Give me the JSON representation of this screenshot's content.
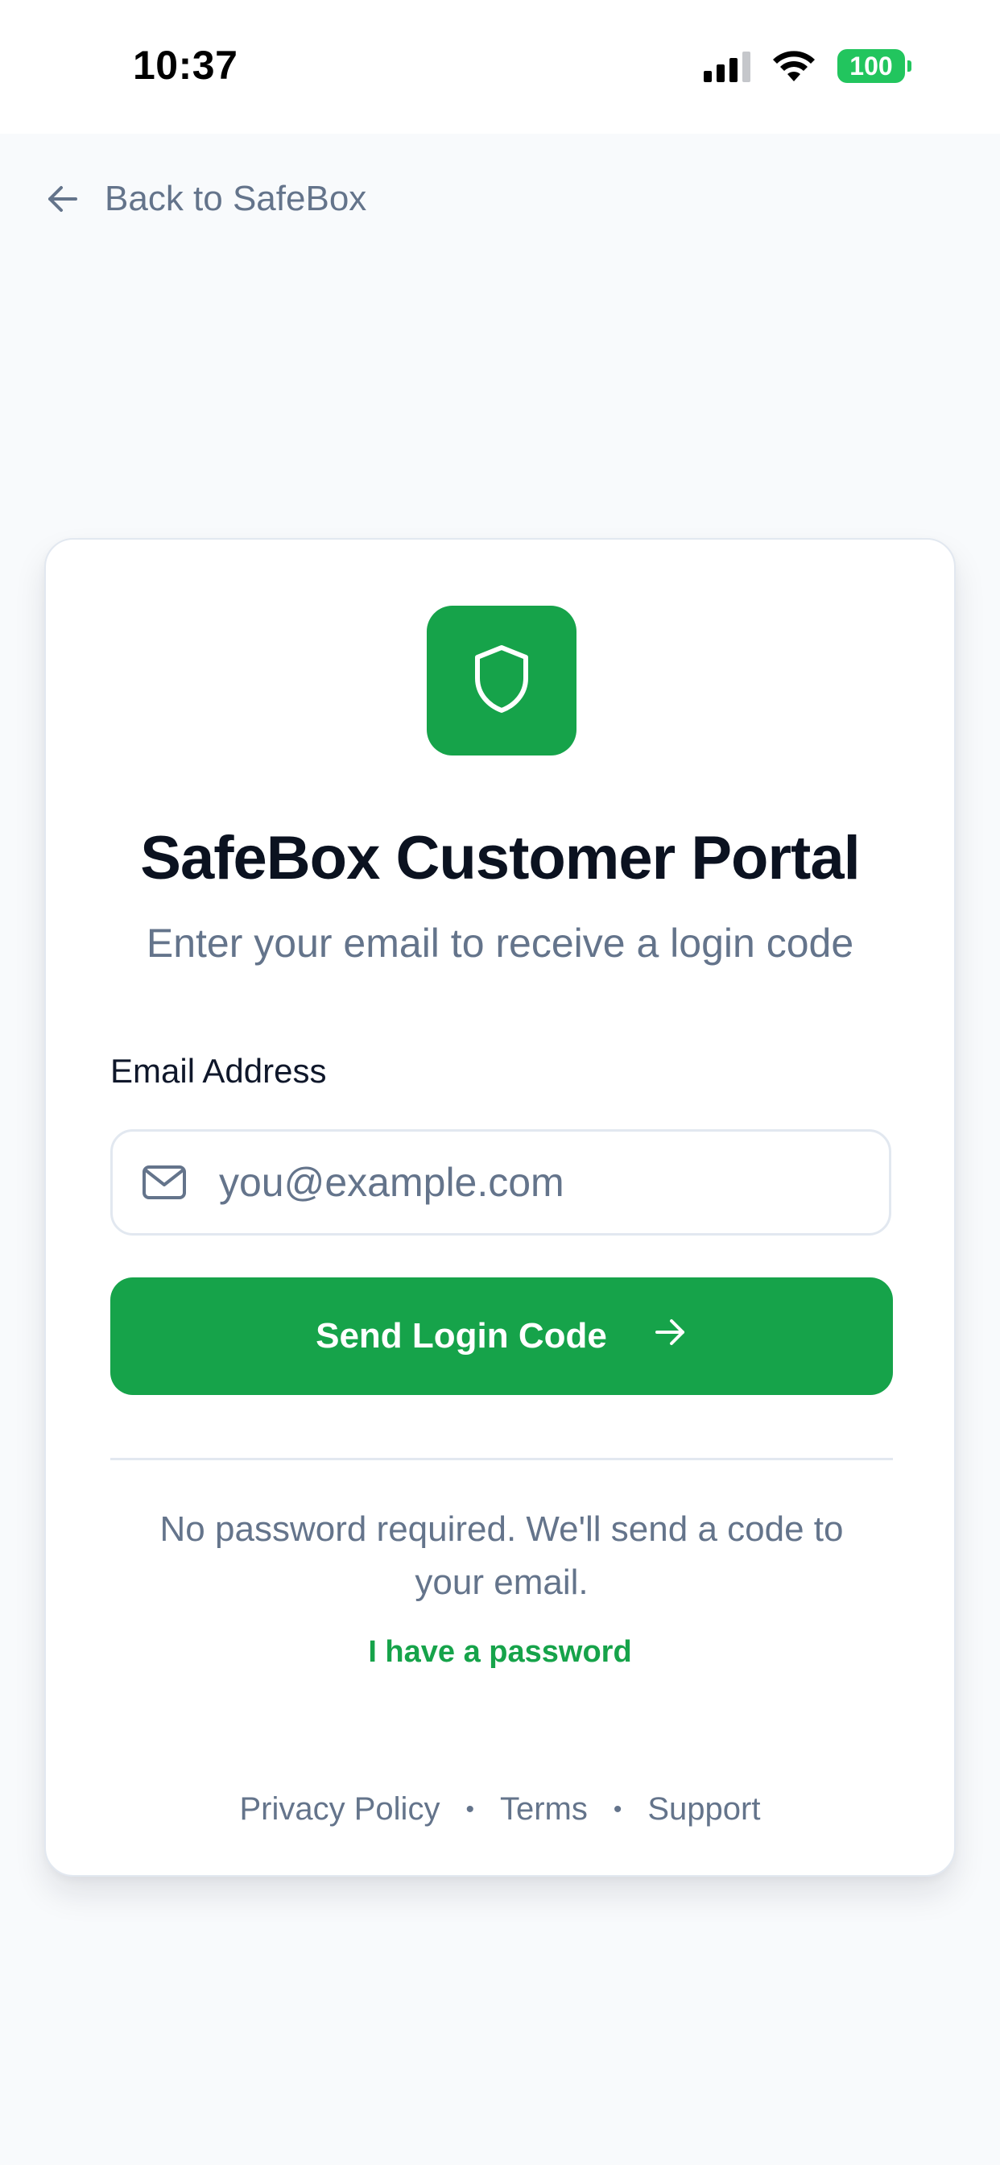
{
  "status_bar": {
    "time": "10:37",
    "battery": "100",
    "icons": [
      "signal-icon",
      "wifi-icon",
      "battery-icon"
    ]
  },
  "nav": {
    "back_label": "Back to SafeBox",
    "back_icon": "arrow-left-icon"
  },
  "card": {
    "logo_icon": "shield-icon",
    "title": "SafeBox Customer Portal",
    "subtitle": "Enter your email to receive a login code",
    "email_label": "Email Address",
    "email_placeholder": "you@example.com",
    "email_value": "",
    "email_icon": "mail-icon",
    "send_button_label": "Send Login Code",
    "send_button_icon": "arrow-right-icon",
    "info_text": "No password required. We'll send a code to your email.",
    "password_link": "I have a password"
  },
  "footer": {
    "links": [
      "Privacy Policy",
      "Terms",
      "Support"
    ],
    "separator": "•"
  },
  "colors": {
    "brand": "#16A34A",
    "background": "#F8FAFC",
    "muted_text": "#64748B",
    "border": "#E2E8F0",
    "battery": "#22C55E"
  }
}
